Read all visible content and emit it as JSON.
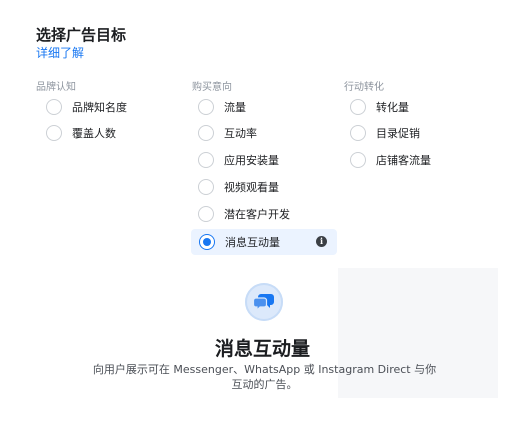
{
  "header": {
    "title": "选择广告目标",
    "learn_more": "详细了解"
  },
  "columns": [
    {
      "heading": "品牌认知",
      "options": [
        "品牌知名度",
        "覆盖人数"
      ]
    },
    {
      "heading": "购买意向",
      "options": [
        "流量",
        "互动率",
        "应用安装量",
        "视频观看量",
        "潜在客户开发",
        "消息互动量"
      ]
    },
    {
      "heading": "行动转化",
      "options": [
        "转化量",
        "目录促销",
        "店铺客流量"
      ]
    }
  ],
  "selected": "消息互动量",
  "detail": {
    "icon": "chat-bubbles-icon",
    "title": "消息互动量",
    "description": "向用户展示可在 Messenger、WhatsApp 或 Instagram Direct 与你互动的广告。"
  },
  "colors": {
    "accent": "#1877f2",
    "selected_bg": "#ebf3ff"
  }
}
